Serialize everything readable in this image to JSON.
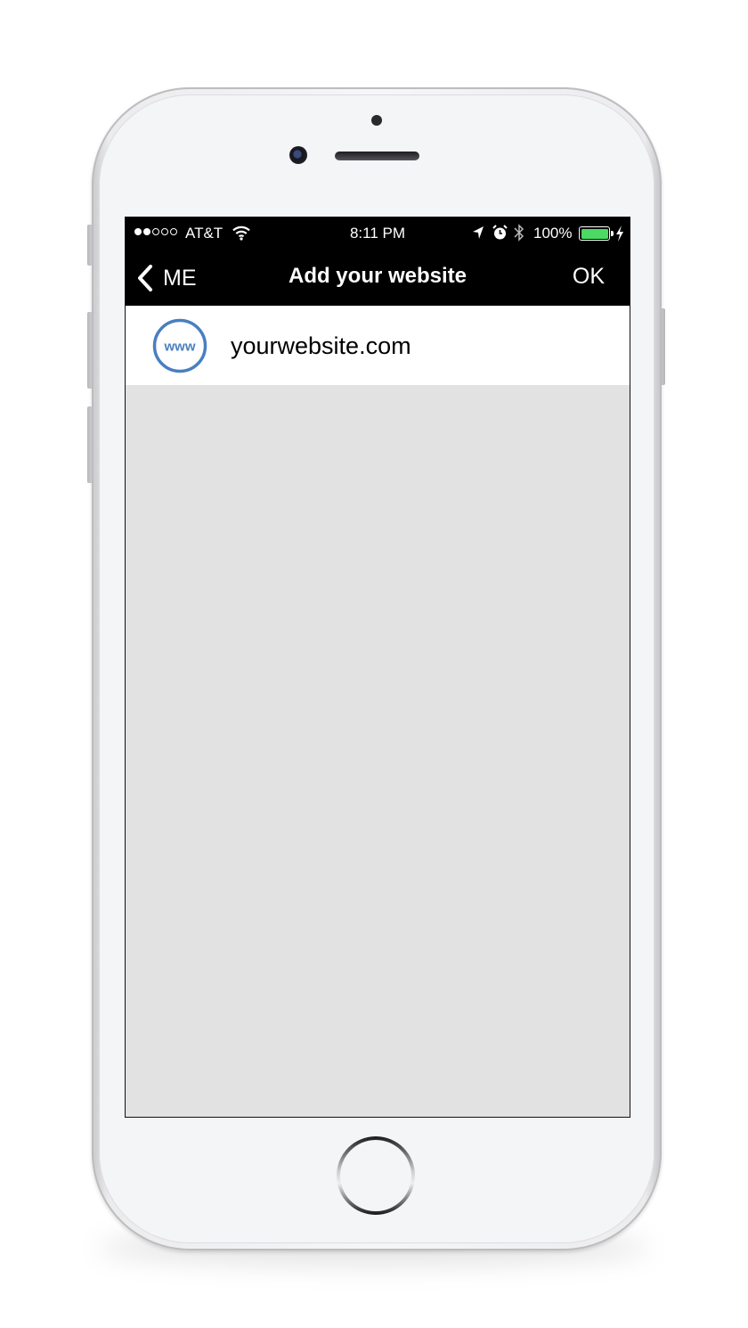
{
  "status_bar": {
    "carrier": "AT&T",
    "signal_bars_filled": 2,
    "signal_bars_total": 5,
    "time": "8:11 PM",
    "battery_percent": "100%",
    "battery_level": 1.0,
    "icons": [
      "wifi-icon",
      "location-icon",
      "alarm-icon",
      "bluetooth-icon",
      "battery-icon",
      "charging-icon"
    ]
  },
  "nav": {
    "back_label": "ME",
    "title": "Add your website",
    "ok_label": "OK"
  },
  "website_field": {
    "icon_text": "www",
    "value": "yourwebsite.com",
    "placeholder": "yourwebsite.com"
  },
  "colors": {
    "nav_background": "#000000",
    "content_background": "#e2e2e2",
    "icon_accent": "#4a7fc1",
    "battery_green": "#4cd964"
  }
}
